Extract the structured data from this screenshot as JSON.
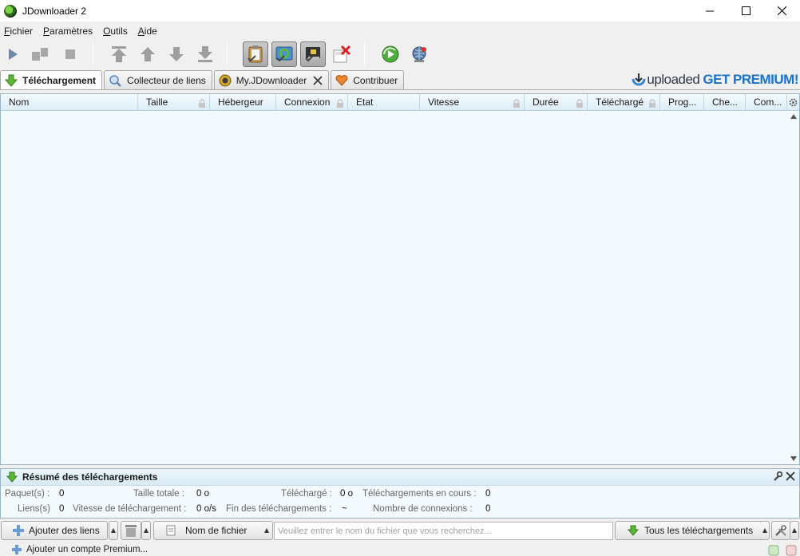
{
  "window": {
    "title": "JDownloader 2"
  },
  "menu": {
    "items": [
      {
        "first": "F",
        "rest": "ichier"
      },
      {
        "first": "P",
        "rest": "aramètres"
      },
      {
        "first": "O",
        "rest": "utils"
      },
      {
        "first": "A",
        "rest": "ide"
      }
    ]
  },
  "toolbar": {
    "icons": [
      "play-icon",
      "pause-icon",
      "stop-icon",
      "move-top-icon",
      "move-up-icon",
      "move-down-icon",
      "move-bottom-icon",
      "clipboard-monitor-icon",
      "auto-reconnect-icon",
      "premium-toggle-icon",
      "silent-mode-icon",
      "update-icon",
      "reconnect-icon"
    ]
  },
  "tabs": [
    {
      "label": "Téléchargement",
      "active": true,
      "icon": "download-arrow-icon"
    },
    {
      "label": "Collecteur de liens",
      "active": false,
      "icon": "linkgrabber-icon"
    },
    {
      "label": "My.JDownloader",
      "active": false,
      "icon": "myjd-icon",
      "closable": true
    },
    {
      "label": "Contribuer",
      "active": false,
      "icon": "heart-icon"
    }
  ],
  "banner": {
    "brand": "uploaded",
    "cta": "GET PREMIUM!"
  },
  "columns": [
    {
      "label": "Nom",
      "lock": false
    },
    {
      "label": "Taille",
      "lock": true
    },
    {
      "label": "Hébergeur",
      "lock": false
    },
    {
      "label": "Connexion",
      "lock": true
    },
    {
      "label": "Etat",
      "lock": false
    },
    {
      "label": "Vitesse",
      "lock": true
    },
    {
      "label": "Durée",
      "lock": true
    },
    {
      "label": "Téléchargé",
      "lock": true
    },
    {
      "label": "Prog...",
      "lock": false
    },
    {
      "label": "Che...",
      "lock": false
    },
    {
      "label": "Com...",
      "lock": false
    }
  ],
  "summary": {
    "title": "Résumé des téléchargements",
    "stats": {
      "packages_label": "Paquet(s) :",
      "packages_value": "0",
      "links_label": "Liens(s)",
      "links_value": "0",
      "total_size_label": "Taille totale :",
      "total_size_value": "0 o",
      "speed_label": "Vitesse de téléchargement :",
      "speed_value": "0 o/s",
      "downloaded_label": "Téléchargé :",
      "downloaded_value": "0 o",
      "eta_label": "Fin des téléchargements :",
      "eta_value": "~",
      "running_label": "Téléchargements en cours :",
      "running_value": "0",
      "connections_label": "Nombre de connexions :",
      "connections_value": "0"
    }
  },
  "bottombar": {
    "add_links_label": "Ajouter des liens",
    "filter_field_label": "Nom de fichier",
    "search_placeholder": "Veuillez entrer le nom du fichier que vous recherchez...",
    "view_label": "Tous les téléchargements"
  },
  "status": {
    "add_premium_label": "Ajouter un compte Premium..."
  }
}
